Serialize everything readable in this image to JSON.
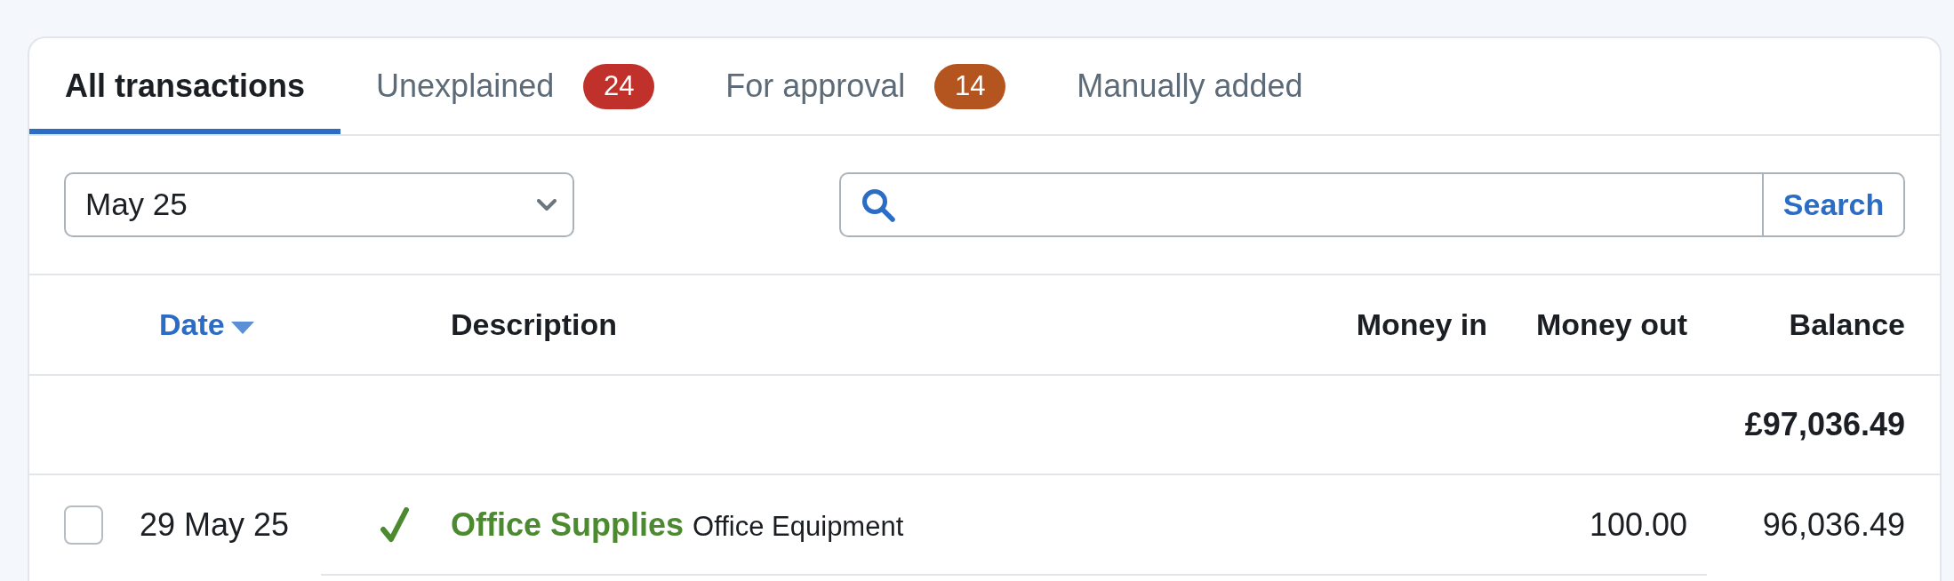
{
  "tabs": [
    {
      "label": "All transactions",
      "selected": true
    },
    {
      "label": "Unexplained",
      "selected": false,
      "badge": {
        "count": "24",
        "color": "#c1312b"
      }
    },
    {
      "label": "For approval",
      "selected": false,
      "badge": {
        "count": "14",
        "color": "#b4541f"
      }
    },
    {
      "label": "Manually added",
      "selected": false
    }
  ],
  "filters": {
    "period": {
      "value": "May 25"
    },
    "search": {
      "button": "Search"
    }
  },
  "table": {
    "columns": [
      {
        "label": "Date",
        "sorted": true
      },
      {
        "label": "Description",
        "sorted": false
      },
      {
        "label": "Money in",
        "sorted": false
      },
      {
        "label": "Money out",
        "sorted": false
      },
      {
        "label": "Balance",
        "sorted": false
      }
    ],
    "opening_balance": "£97,036.49",
    "rows": [
      {
        "checked": false,
        "date": "29 May 25",
        "explained": true,
        "title": "Office Supplies",
        "category": "Office Equipment",
        "money_out": "100.00",
        "balance": "96,036.49"
      }
    ]
  }
}
